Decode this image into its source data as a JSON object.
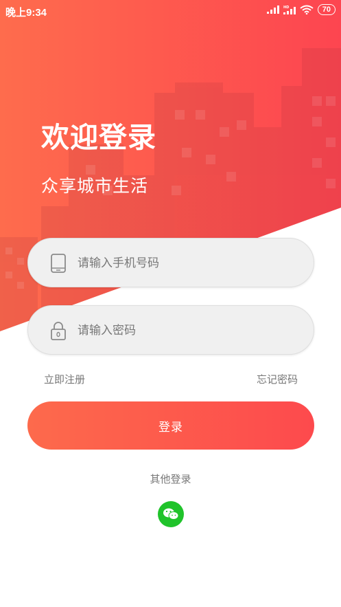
{
  "status_bar": {
    "time": "晚上9:34",
    "battery": "70",
    "icons": [
      "signal-icon",
      "hd-signal-icon",
      "wifi-icon",
      "battery-icon"
    ]
  },
  "header": {
    "title": "欢迎登录",
    "subtitle": "众享城市生活"
  },
  "form": {
    "phone_placeholder": "请输入手机号码",
    "password_placeholder": "请输入密码"
  },
  "links": {
    "register": "立即注册",
    "forgot_password": "忘记密码"
  },
  "login_button": "登录",
  "other_login": {
    "label": "其他登录",
    "method": "wechat-icon"
  },
  "colors": {
    "accent_start": "#fd6a4c",
    "accent_end": "#fd4a4d",
    "wechat_green": "#20c32b"
  }
}
